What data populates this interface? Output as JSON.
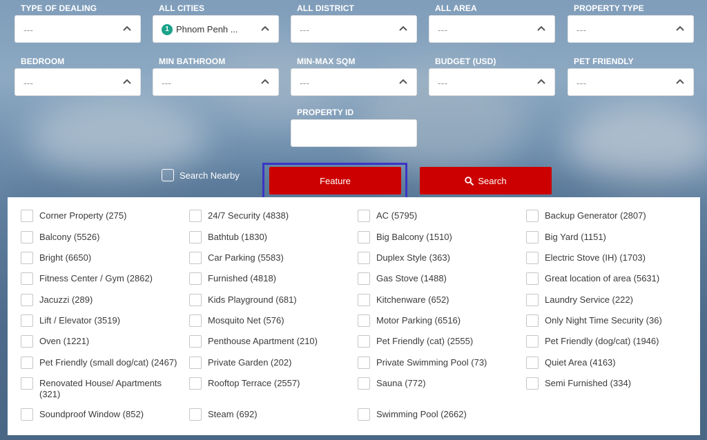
{
  "filters": {
    "type_of_dealing": {
      "label": "TYPE OF DEALING",
      "value": "---"
    },
    "all_cities": {
      "label": "ALL CITIES",
      "badge": "1",
      "value": "Phnom Penh ..."
    },
    "all_district": {
      "label": "ALL DISTRICT",
      "value": "---"
    },
    "all_area": {
      "label": "ALL AREA",
      "value": "---"
    },
    "property_type": {
      "label": "PROPERTY TYPE",
      "value": "---"
    },
    "bedroom": {
      "label": "BEDROOM",
      "value": "---"
    },
    "min_bathroom": {
      "label": "MIN BATHROOM",
      "value": "---"
    },
    "min_max_sqm": {
      "label": "MIN-MAX SQM",
      "value": "---"
    },
    "budget": {
      "label": "BUDGET (USD)",
      "value": "---"
    },
    "pet_friendly": {
      "label": "PET FRIENDLY",
      "value": "---"
    },
    "property_id": {
      "label": "PROPERTY ID",
      "value": ""
    }
  },
  "search_nearby": {
    "label": "Search Nearby",
    "checked": false
  },
  "buttons": {
    "feature": "Feature",
    "search": "Search"
  },
  "colors": {
    "accent": "#cc0000",
    "focus": "#3a35c6",
    "badge": "#1aa38a"
  },
  "features": [
    [
      "Corner Property (275)",
      "24/7 Security (4838)",
      "AC (5795)",
      "Backup Generator (2807)"
    ],
    [
      "Balcony (5526)",
      "Bathtub (1830)",
      "Big Balcony (1510)",
      "Big Yard (1151)"
    ],
    [
      "Bright (6650)",
      "Car Parking (5583)",
      "Duplex Style (363)",
      "Electric Stove (IH) (1703)"
    ],
    [
      "Fitness Center / Gym (2862)",
      "Furnished (4818)",
      "Gas Stove (1488)",
      "Great location of area (5631)"
    ],
    [
      "Jacuzzi (289)",
      "Kids Playground (681)",
      "Kitchenware (652)",
      "Laundry Service (222)"
    ],
    [
      "Lift / Elevator (3519)",
      "Mosquito Net (576)",
      "Motor Parking (6516)",
      "Only Night Time Security (36)"
    ],
    [
      "Oven (1221)",
      "Penthouse Apartment (210)",
      "Pet Friendly (cat) (2555)",
      "Pet Friendly (dog/cat) (1946)"
    ],
    [
      "Pet Friendly (small dog/cat) (2467)",
      "Private Garden (202)",
      "Private Swimming Pool (73)",
      "Quiet Area (4163)"
    ],
    [
      "Renovated House/ Apartments (321)",
      "Rooftop Terrace (2557)",
      "Sauna (772)",
      "Semi Furnished (334)"
    ],
    [
      "Soundproof Window (852)",
      "Steam (692)",
      "Swimming Pool (2662)"
    ]
  ]
}
